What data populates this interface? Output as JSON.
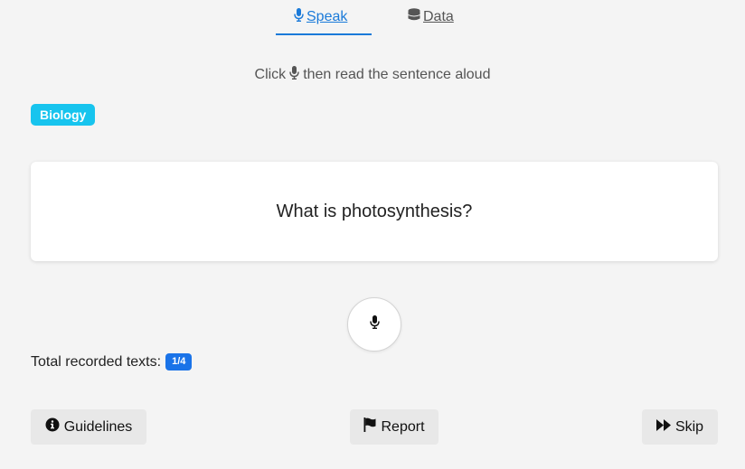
{
  "tabs": [
    {
      "label": "Speak",
      "icon": "microphone-icon",
      "active": true
    },
    {
      "label": "Data",
      "icon": "database-icon",
      "active": false
    }
  ],
  "instruction": {
    "prefix": "Click",
    "icon": "microphone-icon",
    "suffix": "then read the sentence aloud"
  },
  "category": {
    "label": "Biology",
    "color": "#17c4ee"
  },
  "sentence": "What is photosynthesis?",
  "record_button": {
    "icon": "microphone-icon"
  },
  "progress": {
    "label": "Total recorded texts:",
    "count": "1/4"
  },
  "actions": {
    "guidelines_label": "Guidelines",
    "report_label": "Report",
    "skip_label": "Skip"
  },
  "colors": {
    "accent": "#1a7ad9",
    "badge_blue": "#1a73e8",
    "category_cyan": "#17c4ee",
    "background": "#f4f4f4"
  }
}
